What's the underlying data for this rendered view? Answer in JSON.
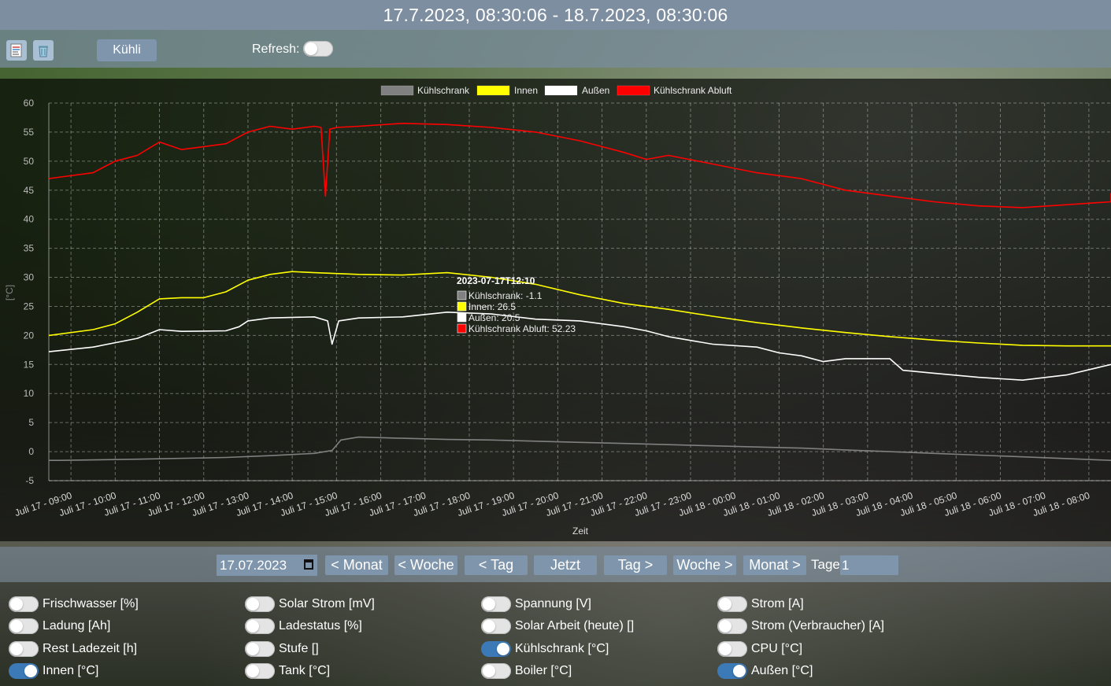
{
  "header": {
    "title": "17.7.2023, 08:30:06 - 18.7.2023, 08:30:06"
  },
  "toolbar": {
    "export_icon": "document-icon",
    "delete_icon": "trash-icon",
    "kuehli_label": "Kühli",
    "refresh_label": "Refresh:",
    "refresh_on": false
  },
  "chart_data": {
    "type": "line",
    "xlabel": "Zeit",
    "ylabel": "[°C]",
    "ylim": [
      -5,
      60
    ],
    "yticks": [
      "60",
      "55",
      "50",
      "45",
      "40",
      "35",
      "30",
      "25",
      "20",
      "15",
      "10",
      "5",
      "0",
      "-5"
    ],
    "x": [
      "Juli 17 - 09:00",
      "Juli 17 - 10:00",
      "Juli 17 - 11:00",
      "Juli 17 - 12:00",
      "Juli 17 - 13:00",
      "Juli 17 - 14:00",
      "Juli 17 - 15:00",
      "Juli 17 - 16:00",
      "Juli 17 - 17:00",
      "Juli 17 - 18:00",
      "Juli 17 - 19:00",
      "Juli 17 - 20:00",
      "Juli 17 - 21:00",
      "Juli 17 - 22:00",
      "Juli 17 - 23:00",
      "Juli 18 - 00:00",
      "Juli 18 - 01:00",
      "Juli 18 - 02:00",
      "Juli 18 - 03:00",
      "Juli 18 - 04:00",
      "Juli 18 - 05:00",
      "Juli 18 - 06:00",
      "Juli 18 - 07:00",
      "Juli 18 - 08:00"
    ],
    "x_start": "Juli 17 - 08:30",
    "x_end": "Juli 18 - 08:30",
    "grid": true,
    "legend_position": "top-center",
    "series": [
      {
        "name": "Kühlschrank",
        "color": "#808080",
        "points": [
          [
            0,
            -1.5
          ],
          [
            0.25,
            -1.5
          ],
          [
            2,
            -1.3
          ],
          [
            4,
            -1.0
          ],
          [
            5,
            -0.7
          ],
          [
            6,
            -0.3
          ],
          [
            6.4,
            0.2
          ],
          [
            6.6,
            2.0
          ],
          [
            7,
            2.5
          ],
          [
            8,
            2.3
          ],
          [
            9,
            2.1
          ],
          [
            10,
            2.0
          ],
          [
            11,
            1.8
          ],
          [
            12,
            1.6
          ],
          [
            13,
            1.4
          ],
          [
            14,
            1.2
          ],
          [
            15,
            1.0
          ],
          [
            16,
            0.8
          ],
          [
            17,
            0.6
          ],
          [
            18,
            0.3
          ],
          [
            19,
            0.0
          ],
          [
            20,
            -0.3
          ],
          [
            21,
            -0.6
          ],
          [
            22,
            -0.9
          ],
          [
            23,
            -1.2
          ],
          [
            24,
            -1.5
          ]
        ]
      },
      {
        "name": "Innen",
        "color": "#ffff00",
        "points": [
          [
            0,
            20.0
          ],
          [
            1,
            21.0
          ],
          [
            1.5,
            22.0
          ],
          [
            2,
            24.0
          ],
          [
            2.5,
            26.3
          ],
          [
            3,
            26.5
          ],
          [
            3.5,
            26.5
          ],
          [
            4,
            27.5
          ],
          [
            4.5,
            29.5
          ],
          [
            5,
            30.5
          ],
          [
            5.5,
            31.0
          ],
          [
            6,
            30.8
          ],
          [
            7,
            30.5
          ],
          [
            8,
            30.4
          ],
          [
            9,
            30.8
          ],
          [
            10,
            30.0
          ],
          [
            11,
            28.8
          ],
          [
            12,
            27.0
          ],
          [
            13,
            25.5
          ],
          [
            14,
            24.5
          ],
          [
            15,
            23.3
          ],
          [
            16,
            22.2
          ],
          [
            17,
            21.3
          ],
          [
            18,
            20.5
          ],
          [
            19,
            19.8
          ],
          [
            20,
            19.2
          ],
          [
            21,
            18.7
          ],
          [
            22,
            18.3
          ],
          [
            23,
            18.2
          ],
          [
            24,
            18.2
          ]
        ]
      },
      {
        "name": "Außen",
        "color": "#ffffff",
        "points": [
          [
            0,
            17.2
          ],
          [
            1,
            18.0
          ],
          [
            2,
            19.5
          ],
          [
            2.5,
            21.0
          ],
          [
            3,
            20.7
          ],
          [
            4,
            20.8
          ],
          [
            4.3,
            21.5
          ],
          [
            4.5,
            22.5
          ],
          [
            5,
            23.0
          ],
          [
            6,
            23.2
          ],
          [
            6.3,
            22.5
          ],
          [
            6.4,
            18.5
          ],
          [
            6.55,
            22.5
          ],
          [
            7,
            23.0
          ],
          [
            8,
            23.2
          ],
          [
            9,
            24.0
          ],
          [
            10,
            23.7
          ],
          [
            11,
            22.8
          ],
          [
            12,
            22.5
          ],
          [
            13,
            21.5
          ],
          [
            13.5,
            20.8
          ],
          [
            14,
            19.8
          ],
          [
            15,
            18.5
          ],
          [
            16,
            18.0
          ],
          [
            16.5,
            17.0
          ],
          [
            17,
            16.5
          ],
          [
            17.5,
            15.5
          ],
          [
            18,
            16.0
          ],
          [
            19,
            16.0
          ],
          [
            19.3,
            14.0
          ],
          [
            20,
            13.5
          ],
          [
            21,
            12.8
          ],
          [
            22,
            12.3
          ],
          [
            23,
            13.2
          ],
          [
            24,
            15.0
          ]
        ]
      },
      {
        "name": "Kühlschrank Abluft",
        "color": "#ff0000",
        "points": [
          [
            0,
            47.0
          ],
          [
            1,
            48.0
          ],
          [
            1.5,
            50.0
          ],
          [
            2,
            51.0
          ],
          [
            2.5,
            53.3
          ],
          [
            3,
            52.0
          ],
          [
            4,
            53.0
          ],
          [
            4.5,
            55.0
          ],
          [
            5,
            56.0
          ],
          [
            5.5,
            55.5
          ],
          [
            6,
            56.0
          ],
          [
            6.15,
            55.8
          ],
          [
            6.25,
            44.0
          ],
          [
            6.35,
            55.5
          ],
          [
            6.5,
            55.8
          ],
          [
            7,
            56.0
          ],
          [
            8,
            56.5
          ],
          [
            9,
            56.3
          ],
          [
            10,
            55.8
          ],
          [
            11,
            55.0
          ],
          [
            12,
            53.5
          ],
          [
            13,
            51.5
          ],
          [
            13.5,
            50.3
          ],
          [
            14,
            51.0
          ],
          [
            15,
            49.5
          ],
          [
            16,
            48.0
          ],
          [
            17,
            47.0
          ],
          [
            18,
            45.0
          ],
          [
            19,
            44.0
          ],
          [
            20,
            43.0
          ],
          [
            21,
            42.3
          ],
          [
            22,
            42.0
          ],
          [
            23,
            42.5
          ],
          [
            24,
            43.0
          ],
          [
            24,
            44.5
          ]
        ]
      }
    ],
    "tooltip": {
      "title": "2023-07-17T12:10",
      "items": [
        {
          "label": "Kühlschrank: -1.1",
          "color": "#808080"
        },
        {
          "label": "Innen: 26.5",
          "color": "#ffff00"
        },
        {
          "label": "Außen: 20.5",
          "color": "#ffffff"
        },
        {
          "label": "Kühlschrank Abluft: 52.23",
          "color": "#ff0000"
        }
      ]
    }
  },
  "nav": {
    "date_value": "17.07.2023",
    "buttons": [
      "< Monat",
      "< Woche",
      "< Tag",
      "Jetzt",
      "Tag >",
      "Woche >",
      "Monat >"
    ],
    "tage_label": "Tage",
    "tage_value": "1"
  },
  "toggles": {
    "items": [
      {
        "label": "Frischwasser [%]",
        "on": false
      },
      {
        "label": "Solar Strom [mV]",
        "on": false
      },
      {
        "label": "Spannung [V]",
        "on": false
      },
      {
        "label": "Strom [A]",
        "on": false
      },
      {
        "label": "Ladung [Ah]",
        "on": false
      },
      {
        "label": "Ladestatus [%]",
        "on": false
      },
      {
        "label": "Solar Arbeit (heute) []",
        "on": false
      },
      {
        "label": "Strom (Verbraucher) [A]",
        "on": false
      },
      {
        "label": "Rest Ladezeit [h]",
        "on": false
      },
      {
        "label": "Stufe []",
        "on": false
      },
      {
        "label": "Kühlschrank [°C]",
        "on": true
      },
      {
        "label": "CPU [°C]",
        "on": false
      },
      {
        "label": "Innen [°C]",
        "on": true
      },
      {
        "label": "Tank [°C]",
        "on": false
      },
      {
        "label": "Boiler [°C]",
        "on": false
      },
      {
        "label": "Außen [°C]",
        "on": true
      }
    ]
  }
}
